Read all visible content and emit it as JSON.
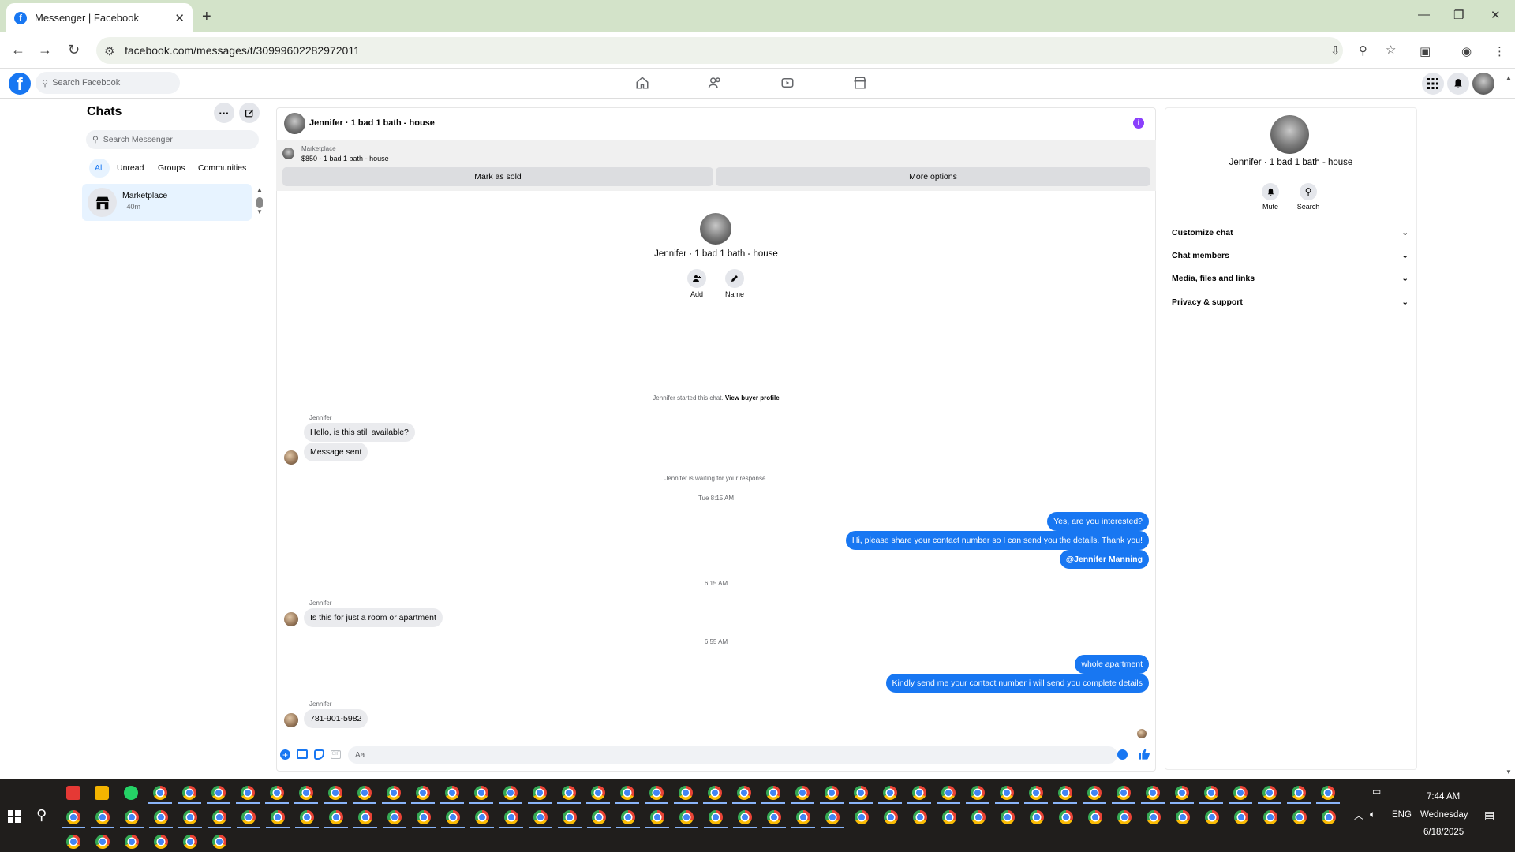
{
  "browser": {
    "tab_title": "Messenger | Facebook",
    "url": "facebook.com/messages/t/30999602282972011",
    "new_tab": "+",
    "close_tab": "✕"
  },
  "fb_header": {
    "search_placeholder": "Search Facebook"
  },
  "left_panel": {
    "title": "Chats",
    "search_placeholder": "Search Messenger",
    "filters": [
      "All",
      "Unread",
      "Groups",
      "Communities"
    ],
    "active_filter": "All",
    "chats": [
      {
        "name": "Marketplace",
        "time": "· 40m"
      }
    ]
  },
  "chat": {
    "header_title": "Jennifer · 1 bad 1 bath - house",
    "marketplace_label": "Marketplace",
    "listing": "$850 - 1 bad 1 bath - house",
    "mark_sold": "Mark as sold",
    "more_options": "More options",
    "profile_name": "Jennifer · 1 bad 1 bath - house",
    "add_label": "Add",
    "name_label": "Name",
    "started_text": "Jennifer started this chat.",
    "view_buyer": "View buyer profile",
    "waiting_text": "Jennifer is waiting for your response.",
    "messages": {
      "s1": "Jennifer",
      "m1": "Hello, is this still available?",
      "m2": "Message sent",
      "t1": "Tue 8:15 AM",
      "o1": "Yes, are you interested?",
      "o2": "Hi, please share your contact number so I can send you the details. Thank you!",
      "o3": "@Jennifer Manning",
      "t2": "6:15 AM",
      "s2": "Jennifer",
      "m3": "Is this for just a room or apartment",
      "t3": "6:55 AM",
      "o4": "whole apartment",
      "o5": "Kindly send me your contact number i will send you complete details",
      "s3": "Jennifer",
      "m4": "781-901-5982"
    },
    "composer_placeholder": "Aa"
  },
  "right_panel": {
    "name": "Jennifer · 1 bad 1 bath - house",
    "mute": "Mute",
    "search": "Search",
    "sections": [
      "Customize chat",
      "Chat members",
      "Media, files and links",
      "Privacy & support"
    ]
  },
  "taskbar": {
    "time": "7:44 AM",
    "day": "Wednesday",
    "date": "6/18/2025",
    "lang": "ENG"
  },
  "colors": {
    "accent": "#1877f2",
    "tabbar": "#d3e3c9",
    "taskbar": "#201e1c"
  }
}
